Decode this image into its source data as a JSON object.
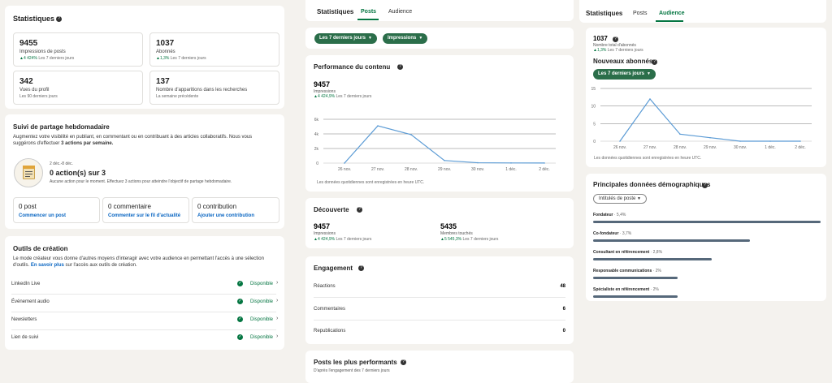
{
  "statistiques": {
    "title": "Statistiques",
    "stats": [
      {
        "value": "9455",
        "label": "Impressions de posts",
        "growth": "▲4 424%",
        "sub": "Les 7 derniers jours"
      },
      {
        "value": "1037",
        "label": "Abonnés",
        "growth": "▲1,3%",
        "sub": "Les 7 derniers jours"
      },
      {
        "value": "342",
        "label": "Vues du profil",
        "growth": "",
        "sub": "Les 90 derniers jours"
      },
      {
        "value": "137",
        "label": "Nombre d'apparitions dans les recherches",
        "growth": "",
        "sub": "La semaine précédente"
      }
    ]
  },
  "suivi": {
    "title": "Suivi de partage hebdomadaire",
    "desc1": "Augmentez votre visibilité en publiant, en commentant ou en contribuant à des articles collaboratifs. Nous vous",
    "desc2": "suggérons d'effectuer ",
    "desc_bold": "3 actions par semaine.",
    "dates": "2 déc.-8 déc.",
    "actions": "0 action(s) sur 3",
    "info": "Aucune action pour le moment. Effectuez 3 actions pour atteindre l'objectif de partage hebdomadaire.",
    "items": [
      {
        "label": "0 post",
        "link": "Commencer un post"
      },
      {
        "label": "0 commentaire",
        "link": "Commenter sur le fil d'actualité"
      },
      {
        "label": "0 contribution",
        "link": "Ajouter une contribution"
      }
    ]
  },
  "outils": {
    "title": "Outils de création",
    "desc1": "Le mode créateur vous donne d'autres moyens d'interagir avec votre audience en permettant l'accès à une sélection",
    "desc2": "d'outils. ",
    "link": "En savoir plus",
    "desc3": " sur l'accès aux outils de création.",
    "status": "Disponible",
    "items": [
      "LinkedIn Live",
      "Événement audio",
      "Newsletters",
      "Lien de suivi"
    ]
  },
  "mid": {
    "tabs": [
      "Statistiques",
      "Posts",
      "Audience"
    ],
    "filters": [
      "Les 7 derniers jours",
      "Impressions"
    ],
    "perf": {
      "title": "Performance du contenu",
      "value": "9457",
      "label": "Impressions",
      "growth": "▲4 424,9%",
      "sub": "Les 7 derniers jours",
      "note": "Les données quotidiennes sont enregistrées en heure UTC."
    },
    "decouverte": {
      "title": "Découverte",
      "a_value": "9457",
      "a_label": "Impressions",
      "a_growth": "▲4 424,9%",
      "a_sub": "Les 7 derniers jours",
      "b_value": "5435",
      "b_label": "Membres touchés",
      "b_growth": "▲5 545,3%",
      "b_sub": "Les 7 derniers jours"
    },
    "engagement": {
      "title": "Engagement",
      "rows": [
        {
          "label": "Réactions",
          "value": "48"
        },
        {
          "label": "Commentaires",
          "value": "6"
        },
        {
          "label": "Republications",
          "value": "0"
        }
      ]
    },
    "top": {
      "title": "Posts les plus performants",
      "sub": "D'après l'engagement des 7 derniers jours"
    }
  },
  "right": {
    "tabs": [
      "Statistiques",
      "Posts",
      "Audience"
    ],
    "followers": "1037",
    "followers_label": "Nombre total d'abonnés",
    "growth": "▲1,3%",
    "sub": "Les 7 derniers jours",
    "new_title": "Nouveaux abonnés",
    "filter": "Les 7 derniers jours",
    "note": "Les données quotidiennes sont enregistrées en heure UTC.",
    "demo": {
      "title": "Principales données démographiques",
      "filter": "Intitulés de poste",
      "items": [
        {
          "name": "Fondateur",
          "pct": "· 5,4%",
          "frac": 1.0
        },
        {
          "name": "Co-fondateur",
          "pct": "· 3,7%",
          "frac": 0.69
        },
        {
          "name": "Consultant en référencement",
          "pct": "· 2,8%",
          "frac": 0.52
        },
        {
          "name": "Responsable communications",
          "pct": "· 2%",
          "frac": 0.37
        },
        {
          "name": "Spécialiste en référencement",
          "pct": "· 2%",
          "frac": 0.37
        }
      ]
    }
  },
  "chart_data": [
    {
      "type": "line",
      "categories": [
        "26 nov.",
        "27 nov.",
        "28 nov.",
        "29 nov.",
        "30 nov.",
        "1 déc.",
        "2 déc."
      ],
      "values": [
        0,
        5100,
        3900,
        350,
        50,
        20,
        10
      ],
      "ylim": [
        0,
        8000
      ],
      "yticks": [
        "0",
        "2k",
        "4k",
        "6k"
      ]
    },
    {
      "type": "line",
      "categories": [
        "26 nov.",
        "27 nov.",
        "28 nov.",
        "29 nov.",
        "30 nov.",
        "1 déc.",
        "2 déc."
      ],
      "values": [
        0,
        12,
        2,
        1,
        0,
        0,
        0
      ],
      "ylim": [
        0,
        15
      ],
      "yticks": [
        "0",
        "5",
        "10",
        "15"
      ]
    }
  ],
  "colors": {
    "accent": "#057642",
    "link": "#0a66c2",
    "line": "#5b9bd5"
  }
}
